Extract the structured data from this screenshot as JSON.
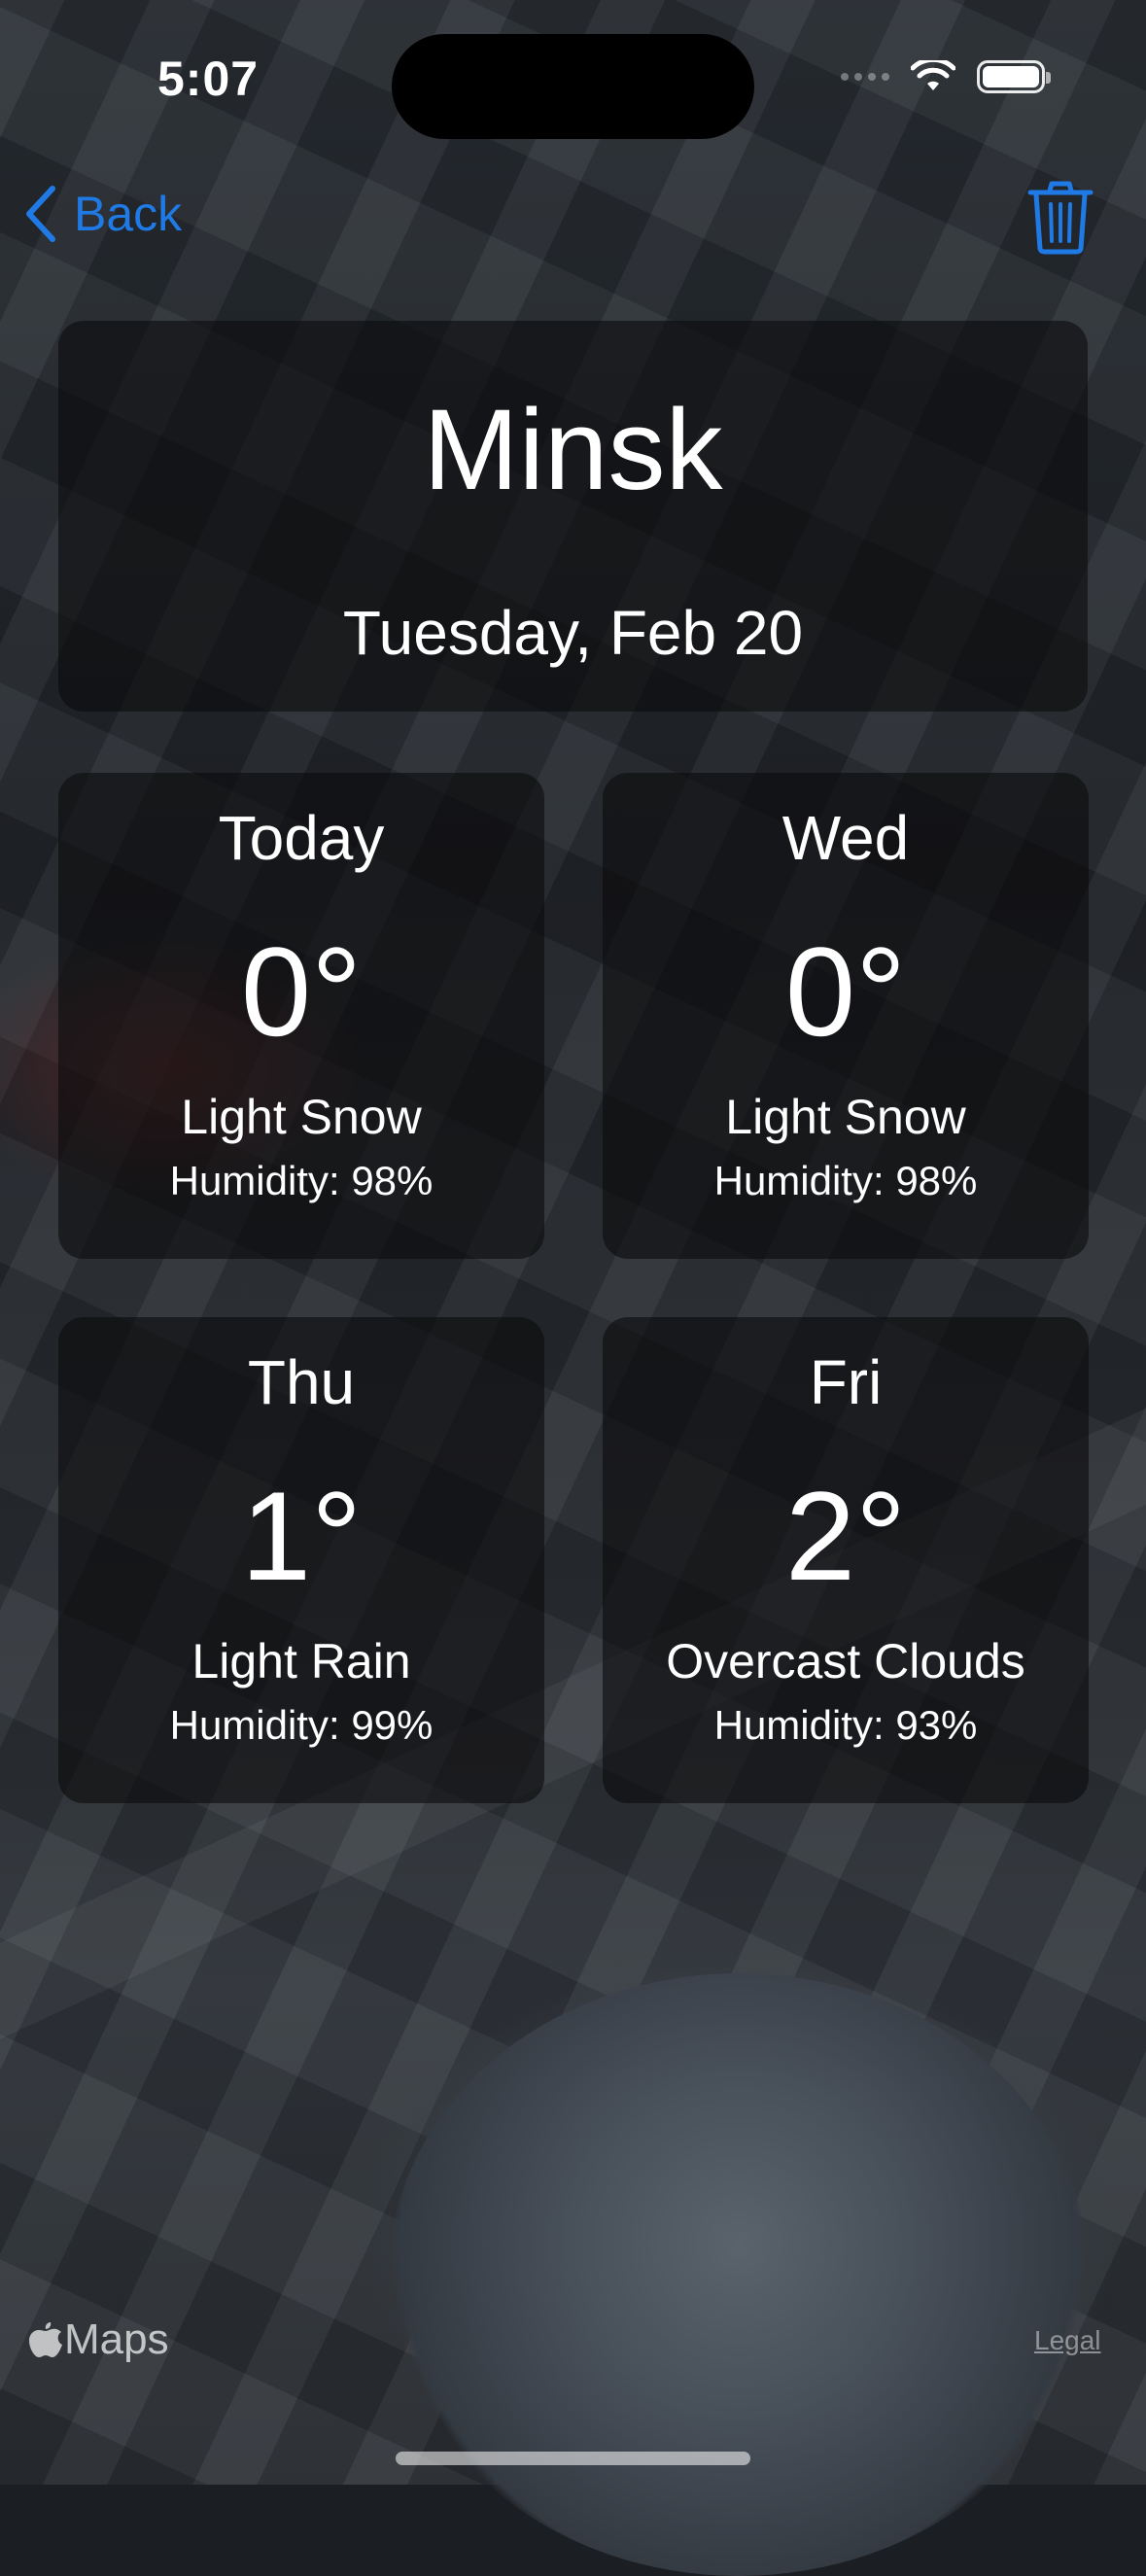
{
  "status_bar": {
    "time": "5:07",
    "icons": [
      "cellular-signal-icon",
      "wifi-icon",
      "battery-icon"
    ]
  },
  "nav": {
    "back_label": "Back",
    "back_icon": "chevron-left-icon",
    "delete_icon": "trash-icon",
    "accent_color": "#1f7ae6"
  },
  "header": {
    "city": "Minsk",
    "date": "Tuesday, Feb 20"
  },
  "forecast": [
    {
      "day": "Today",
      "temp": "0°",
      "description": "Light Snow",
      "humidity": "Humidity: 98%"
    },
    {
      "day": "Wed",
      "temp": "0°",
      "description": "Light Snow",
      "humidity": "Humidity: 98%"
    },
    {
      "day": "Thu",
      "temp": "1°",
      "description": "Light Rain",
      "humidity": "Humidity: 99%"
    },
    {
      "day": "Fri",
      "temp": "2°",
      "description": "Overcast Clouds",
      "humidity": "Humidity: 93%"
    }
  ],
  "map": {
    "attribution": "Maps",
    "legal_label": "Legal"
  }
}
